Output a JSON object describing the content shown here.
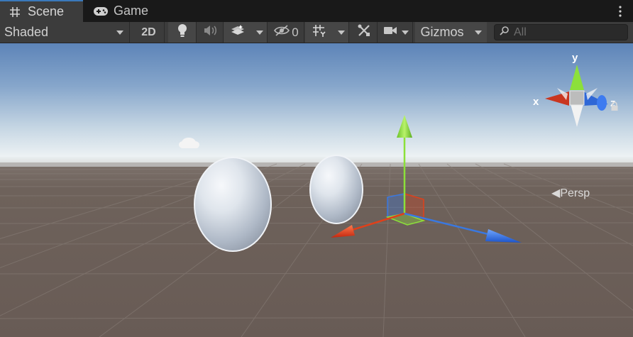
{
  "tabs": [
    {
      "label": "Scene",
      "icon": "scene-grid-icon",
      "active": true
    },
    {
      "label": "Game",
      "icon": "gamepad-icon",
      "active": false
    }
  ],
  "toolbar": {
    "shading_mode": "Shaded",
    "btn_2d": "2D",
    "hidden_count": "0",
    "gizmos_label": "Gizmos",
    "search_placeholder": "All"
  },
  "orientation_gizmo": {
    "x_label": "x",
    "y_label": "y",
    "z_label": "z",
    "projection_label": "Persp"
  },
  "colors": {
    "axis_x": "#e0401a",
    "axis_y": "#8ce03a",
    "axis_z": "#3a78e0",
    "accent_tab": "#3a79bb",
    "ground": "#6b5f58"
  }
}
